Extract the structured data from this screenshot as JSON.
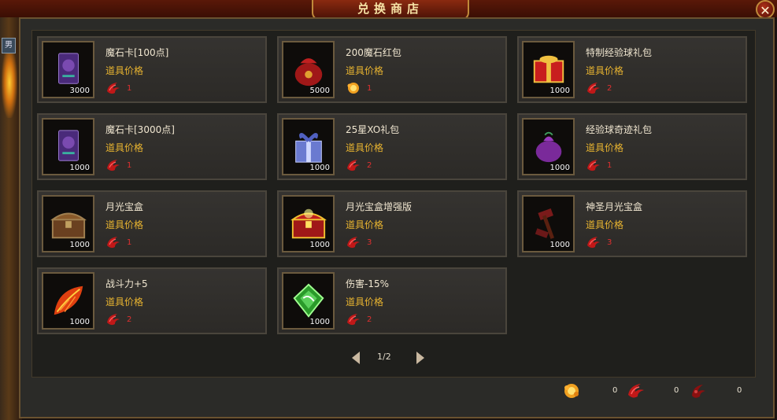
{
  "window": {
    "title": "兑换商店",
    "close_glyph": "✕"
  },
  "side_tag": "男",
  "items": [
    {
      "name": "魔石卡[100点]",
      "qty": "3000",
      "price_label": "道具价格",
      "currency": "red-claw",
      "price": "1",
      "icon": "purple-card-icon"
    },
    {
      "name": "200魔石红包",
      "qty": "5000",
      "price_label": "道具价格",
      "currency": "gold-flame",
      "price": "1",
      "icon": "red-bag-icon"
    },
    {
      "name": "特制经验球礼包",
      "qty": "1000",
      "price_label": "道具价格",
      "currency": "red-claw",
      "price": "2",
      "icon": "exp-box-icon"
    },
    {
      "name": "魔石卡[3000点]",
      "qty": "1000",
      "price_label": "道具价格",
      "currency": "red-claw",
      "price": "1",
      "icon": "purple-card-icon"
    },
    {
      "name": "25星XO礼包",
      "qty": "1000",
      "price_label": "道具价格",
      "currency": "red-claw",
      "price": "2",
      "icon": "blue-gift-icon"
    },
    {
      "name": "经验球奇迹礼包",
      "qty": "1000",
      "price_label": "道具价格",
      "currency": "red-claw",
      "price": "1",
      "icon": "purple-bag-icon"
    },
    {
      "name": "月光宝盒",
      "qty": "1000",
      "price_label": "道具价格",
      "currency": "red-claw",
      "price": "1",
      "icon": "chest-icon"
    },
    {
      "name": "月光宝盒增强版",
      "qty": "1000",
      "price_label": "道具价格",
      "currency": "red-claw",
      "price": "3",
      "icon": "gold-chest-icon"
    },
    {
      "name": "神圣月光宝盒",
      "qty": "1000",
      "price_label": "道具价格",
      "currency": "red-claw",
      "price": "3",
      "icon": "hammer-icon"
    },
    {
      "name": "战斗力+5",
      "qty": "1000",
      "price_label": "道具价格",
      "currency": "red-claw",
      "price": "2",
      "icon": "fire-leaf-icon"
    },
    {
      "name": "伤害-15%",
      "qty": "1000",
      "price_label": "道具价格",
      "currency": "red-claw",
      "price": "2",
      "icon": "green-crystal-icon"
    }
  ],
  "pager": {
    "text": "1/2"
  },
  "footer": {
    "gold_count": "0",
    "red_count": "0",
    "dark_red_count": "0"
  },
  "colors": {
    "price_label": "#e8b430",
    "price_value": "#e03030",
    "frame": "#6a5230"
  }
}
